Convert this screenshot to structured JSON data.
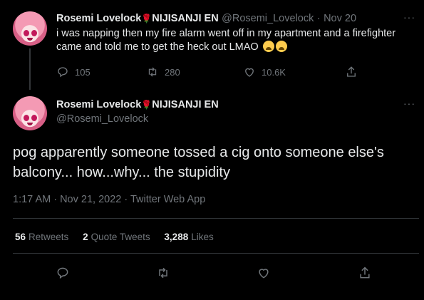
{
  "tweet1": {
    "display_name": "Rosemi Lovelock",
    "name_suffix": "NIJISANJI EN",
    "handle": "@Rosemi_Lovelock",
    "separator": "·",
    "date": "Nov 20",
    "text": "i was napping then my fire alarm went off in my apartment and a firefighter came and told me to get the heck out LMAO",
    "emojis": [
      "loudly-crying-face",
      "loudly-crying-face"
    ],
    "replies": "105",
    "retweets": "280",
    "likes": "10.6K"
  },
  "tweet2": {
    "display_name": "Rosemi Lovelock",
    "name_suffix": "NIJISANJI EN",
    "handle": "@Rosemi_Lovelock",
    "text": "pog apparently someone tossed a cig onto someone else's balcony... how...why... the stupidity",
    "timestamp": "1:17 AM · Nov 21, 2022 · Twitter Web App",
    "retweets_count": "56",
    "retweets_label": "Retweets",
    "quote_count": "2",
    "quote_label": "Quote Tweets",
    "likes_count": "3,288",
    "likes_label": "Likes"
  },
  "more_label": "···",
  "rose_glyph": "🌹",
  "colors": {
    "background": "#000000",
    "text": "#e7e9ea",
    "muted": "#71767b",
    "rose": "#d01c2b"
  }
}
